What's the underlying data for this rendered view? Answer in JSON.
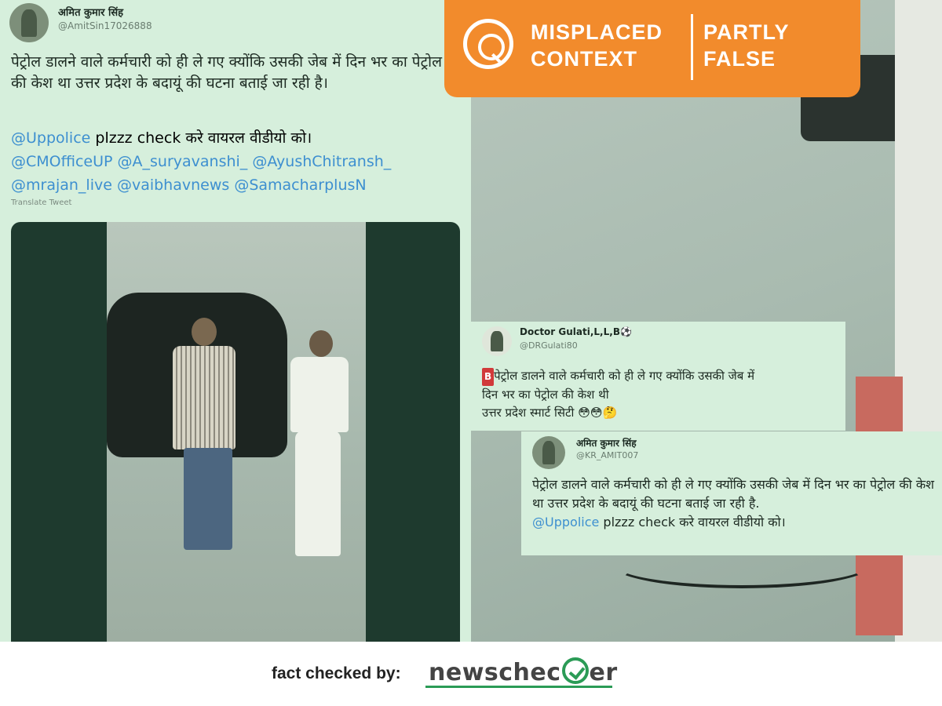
{
  "left_tweet": {
    "name": "अमित कुमार सिंह",
    "handle": "@AmitSin17026888",
    "body": "पेट्रोल डालने वाले कर्मचारी को ही ले गए क्योंकि उसकी जेब में दिन भर का पेट्रोल की केश था उत्तर प्रदेश के बदायूं की घटना बताई जा रही है।",
    "mention_1": "@Uppolice",
    "line_2": " plzzz check करे वायरल वीडीयो को।",
    "mentions_line_3": "@CMOfficeUP @A_suryavanshi_ @AyushChitransh_",
    "mentions_line_4": "@mrajan_live @vaibhavnews @SamacharplusN",
    "translate": "Translate Tweet"
  },
  "badge": {
    "left_line_1": "MISPLACED",
    "left_line_2": "CONTEXT",
    "right_line_1": "PARTLY",
    "right_line_2": "FALSE",
    "color": "#f28b2c"
  },
  "card2": {
    "name": "Doctor Gulati,L,L,B⚽",
    "handle": "@DRGulati80",
    "badge_letter": "B",
    "line_1": "पेट्रोल डालने वाले कर्मचारी को ही ले गए क्योंकि उसकी जेब में",
    "line_2": "दिन भर का पेट्रोल की केश थी",
    "line_3": "उत्तर प्रदेश स्मार्ट सिटी 😳😳🤔"
  },
  "card3": {
    "name": "अमित कुमार सिंह",
    "handle": "@KR_AMIT007",
    "body": "पेट्रोल डालने वाले कर्मचारी को ही ले गए क्योंकि उसकी जेब में दिन भर का पेट्रोल की केश था उत्तर प्रदेश के बदायूं की घटना बताई जा रही है.",
    "mention": "@Uppolice",
    "line_2": " plzzz check करे वायरल वीडीयो को।"
  },
  "footer": {
    "label": "fact checked by:",
    "logo_left": "newschec",
    "logo_right": "er",
    "accent": "#2b9b56"
  }
}
